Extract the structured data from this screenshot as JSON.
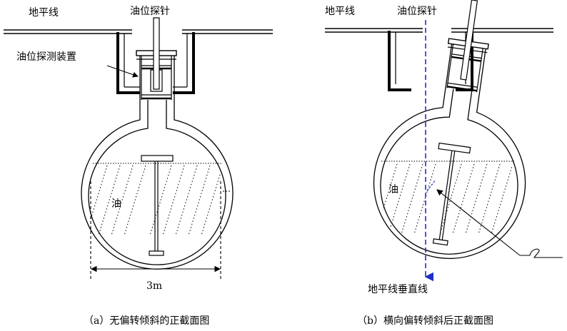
{
  "diagram_a": {
    "ground_label": "地平线",
    "probe_label": "油位探针",
    "device_label": "油位探测装置",
    "oil_label": "油",
    "width_label": "3m",
    "caption": "（a）无偏转倾斜的正截面图"
  },
  "diagram_b": {
    "ground_label": "地平线",
    "probe_label": "油位探针",
    "oil_label": "油",
    "vertical_label": "地平线垂直线",
    "caption": "（b）横向偏转倾斜后正截面图"
  },
  "colors": {
    "line": "#000000",
    "vertical_line": "#1f2ec8"
  }
}
